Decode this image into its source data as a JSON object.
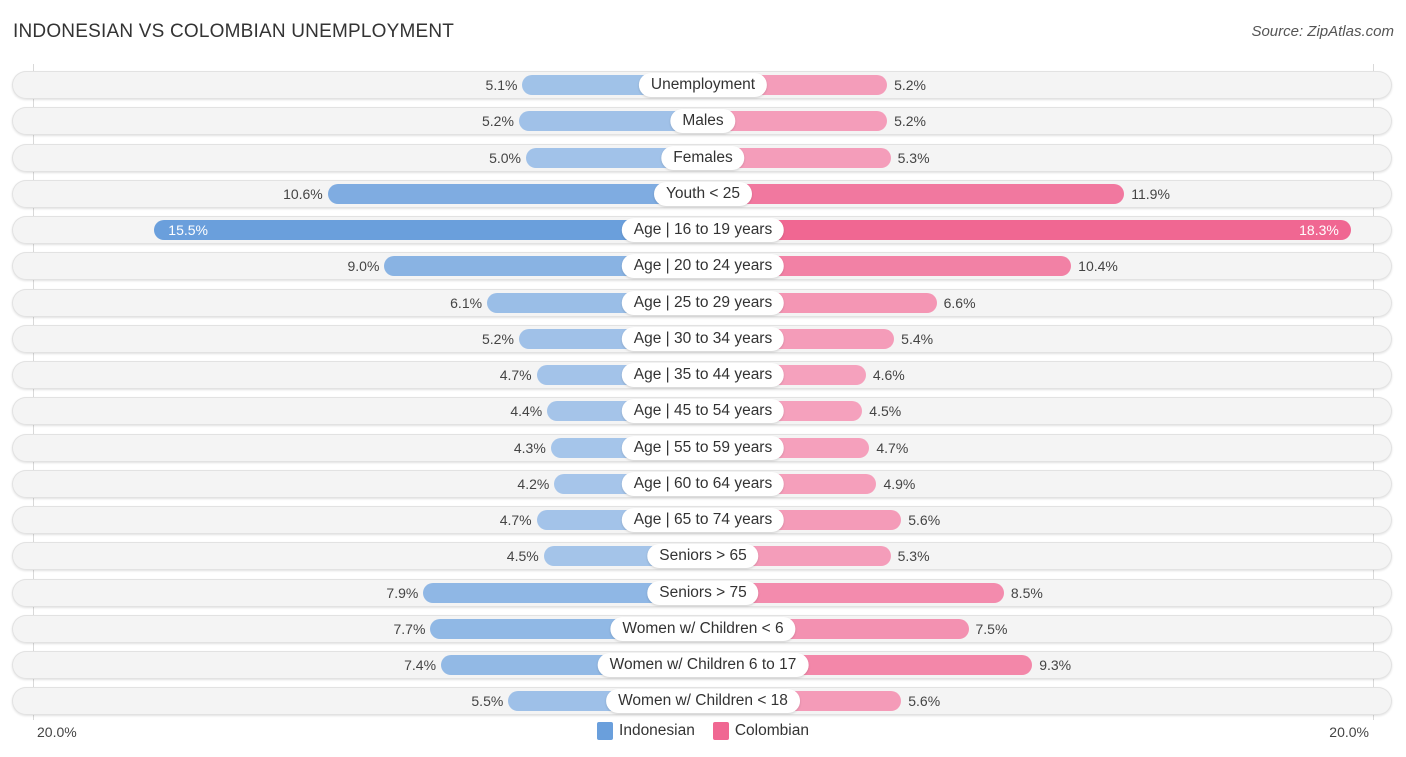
{
  "header": {
    "title": "INDONESIAN VS COLOMBIAN UNEMPLOYMENT",
    "source": "Source: ZipAtlas.com"
  },
  "colors": {
    "indonesian": "#6a9fdc",
    "indonesian_light": "#a7c6ea",
    "colombian": "#f06792",
    "colombian_light": "#f5a4bf"
  },
  "chart_data": {
    "type": "bar",
    "orientation": "horizontal-diverging",
    "title": "INDONESIAN VS COLOMBIAN UNEMPLOYMENT",
    "xlabel": "",
    "ylabel": "",
    "xlim": [
      -20,
      20
    ],
    "axis_labels": {
      "left": "20.0%",
      "right": "20.0%"
    },
    "legend": {
      "position": "bottom-center",
      "entries": [
        "Indonesian",
        "Colombian"
      ]
    },
    "categories": [
      "Unemployment",
      "Males",
      "Females",
      "Youth < 25",
      "Age | 16 to 19 years",
      "Age | 20 to 24 years",
      "Age | 25 to 29 years",
      "Age | 30 to 34 years",
      "Age | 35 to 44 years",
      "Age | 45 to 54 years",
      "Age | 55 to 59 years",
      "Age | 60 to 64 years",
      "Age | 65 to 74 years",
      "Seniors > 65",
      "Seniors > 75",
      "Women w/ Children < 6",
      "Women w/ Children 6 to 17",
      "Women w/ Children < 18"
    ],
    "series": [
      {
        "name": "Indonesian",
        "side": "left",
        "values": [
          5.1,
          5.2,
          5.0,
          10.6,
          15.5,
          9.0,
          6.1,
          5.2,
          4.7,
          4.4,
          4.3,
          4.2,
          4.7,
          4.5,
          7.9,
          7.7,
          7.4,
          5.5
        ],
        "labels": [
          "5.1%",
          "5.2%",
          "5.0%",
          "10.6%",
          "15.5%",
          "9.0%",
          "6.1%",
          "5.2%",
          "4.7%",
          "4.4%",
          "4.3%",
          "4.2%",
          "4.7%",
          "4.5%",
          "7.9%",
          "7.7%",
          "7.4%",
          "5.5%"
        ]
      },
      {
        "name": "Colombian",
        "side": "right",
        "values": [
          5.2,
          5.2,
          5.3,
          11.9,
          18.3,
          10.4,
          6.6,
          5.4,
          4.6,
          4.5,
          4.7,
          4.9,
          5.6,
          5.3,
          8.5,
          7.5,
          9.3,
          5.6
        ],
        "labels": [
          "5.2%",
          "5.2%",
          "5.3%",
          "11.9%",
          "18.3%",
          "10.4%",
          "6.6%",
          "5.4%",
          "4.6%",
          "4.5%",
          "4.7%",
          "4.9%",
          "5.6%",
          "5.3%",
          "8.5%",
          "7.5%",
          "9.3%",
          "5.6%"
        ]
      }
    ]
  }
}
